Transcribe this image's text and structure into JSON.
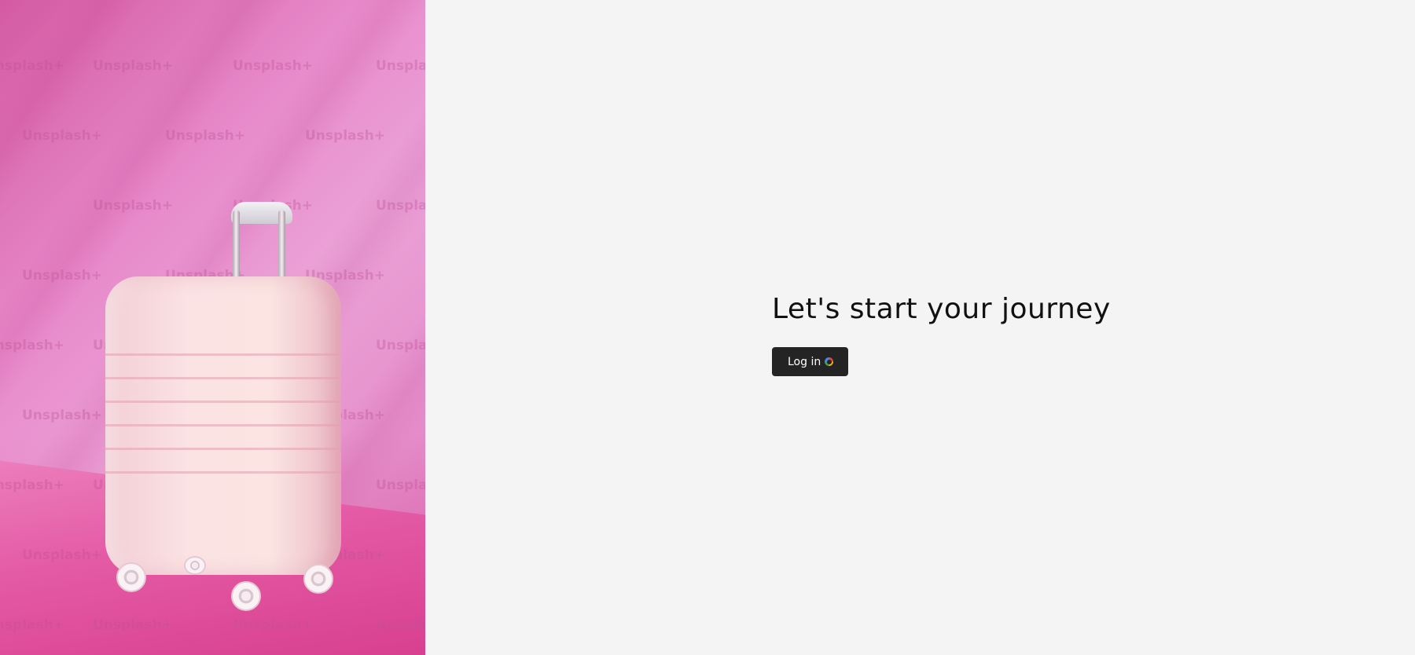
{
  "hero": {
    "watermark_text": "Unsplash+"
  },
  "main": {
    "heading": "Let's start your journey",
    "login_button_label": "Log in",
    "login_icon": "google-icon"
  }
}
